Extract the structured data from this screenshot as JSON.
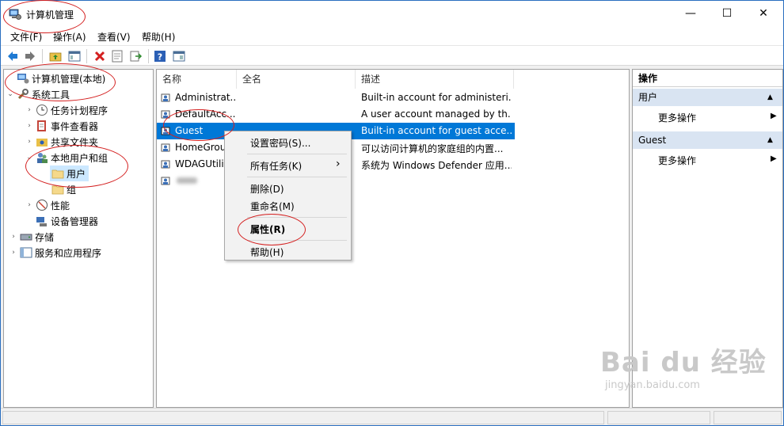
{
  "window": {
    "title": "计算机管理",
    "controls": {
      "minimize": "—",
      "maximize": "☐",
      "close": "✕"
    }
  },
  "menubar": [
    "文件(F)",
    "操作(A)",
    "查看(V)",
    "帮助(H)"
  ],
  "toolbar": {
    "icons": [
      "back-arrow-icon",
      "forward-arrow-icon",
      "up-folder-icon",
      "show-hide-tree-icon",
      "delete-icon",
      "properties-icon",
      "export-list-icon",
      "help-icon",
      "view-icon"
    ]
  },
  "tree": {
    "items": [
      {
        "label": "计算机管理(本地)",
        "level": 0,
        "expand": "",
        "icon": "computer-management-icon"
      },
      {
        "label": "系统工具",
        "level": 0,
        "expand": "open",
        "icon": "tools-icon"
      },
      {
        "label": "任务计划程序",
        "level": 1,
        "expand": "closed",
        "icon": "clock-icon"
      },
      {
        "label": "事件查看器",
        "level": 1,
        "expand": "closed",
        "icon": "event-viewer-icon"
      },
      {
        "label": "共享文件夹",
        "level": 1,
        "expand": "closed",
        "icon": "shared-folder-icon"
      },
      {
        "label": "本地用户和组",
        "level": 1,
        "expand": "open",
        "icon": "users-group-icon"
      },
      {
        "label": "用户",
        "level": 2,
        "expand": "",
        "icon": "folder-icon",
        "selected": true
      },
      {
        "label": "组",
        "level": 2,
        "expand": "",
        "icon": "folder-icon"
      },
      {
        "label": "性能",
        "level": 1,
        "expand": "closed",
        "icon": "performance-icon"
      },
      {
        "label": "设备管理器",
        "level": 1,
        "expand": "",
        "icon": "device-manager-icon"
      },
      {
        "label": "存储",
        "level": 0,
        "expand": "closed",
        "icon": "storage-icon"
      },
      {
        "label": "服务和应用程序",
        "level": 0,
        "expand": "closed",
        "icon": "services-icon"
      }
    ]
  },
  "list": {
    "columns": [
      "名称",
      "全名",
      "描述"
    ],
    "rows": [
      {
        "name": "Administrat...",
        "fullname": "",
        "description": "Built-in account for administeri..."
      },
      {
        "name": "DefaultAcc...",
        "fullname": "",
        "description": "A user account managed by th..."
      },
      {
        "name": "Guest",
        "fullname": "",
        "description": "Built-in account for guest acce...",
        "selected": true
      },
      {
        "name": "HomeGrou...",
        "fullname": "",
        "description": "可以访问计算机的家庭组的内置..."
      },
      {
        "name": "WDAGUtili...",
        "fullname": "",
        "description": "系统为 Windows Defender 应用..."
      },
      {
        "name": "",
        "fullname": "",
        "description": ""
      }
    ]
  },
  "context_menu": {
    "items": [
      "设置密码(S)...",
      "所有任务(K)",
      "删除(D)",
      "重命名(M)",
      "属性(R)",
      "帮助(H)"
    ],
    "submenu_arrow": "›"
  },
  "actions": {
    "header": "操作",
    "sections": [
      {
        "title": "用户",
        "item": "更多操作"
      },
      {
        "title": "Guest",
        "item": "更多操作"
      }
    ],
    "collapse_glyph": "▲",
    "more_glyph": "▶"
  },
  "watermark": {
    "big": "Bai du 经验",
    "small": "jingyan.baidu.com"
  },
  "colors": {
    "selection": "#0078d7",
    "annotation": "#d42020",
    "tree_selected": "#cce8ff",
    "section_header": "#d9e4f2"
  }
}
